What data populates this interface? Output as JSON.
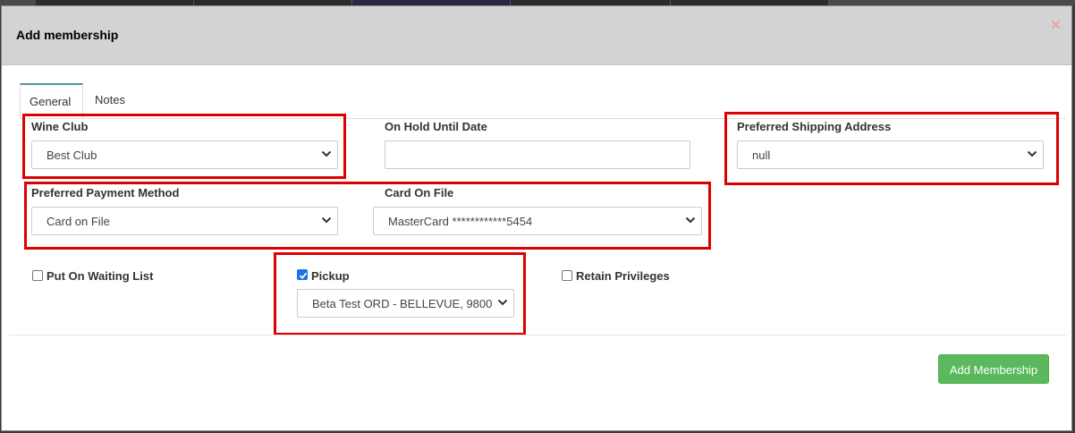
{
  "modal": {
    "title": "Add membership",
    "close_label": "×"
  },
  "tabs": [
    {
      "label": "General",
      "active": true
    },
    {
      "label": "Notes",
      "active": false
    }
  ],
  "form": {
    "wine_club": {
      "label": "Wine Club",
      "value": "Best Club"
    },
    "on_hold_until_date": {
      "label": "On Hold Until Date",
      "value": ""
    },
    "preferred_shipping_address": {
      "label": "Preferred Shipping Address",
      "value": "null"
    },
    "preferred_payment_method": {
      "label": "Preferred Payment Method",
      "value": "Card on File"
    },
    "card_on_file": {
      "label": "Card On File",
      "value": "MasterCard ************5454"
    },
    "put_on_waiting_list": {
      "label": "Put On Waiting List",
      "checked": false
    },
    "pickup": {
      "label": "Pickup",
      "checked": true,
      "location_value": "Beta Test ORD - BELLEVUE, 9800"
    },
    "retain_privileges": {
      "label": "Retain Privileges",
      "checked": false
    }
  },
  "footer": {
    "submit_label": "Add Membership"
  },
  "colors": {
    "header_bg": "#d3d3d3",
    "highlight": "#dd0000",
    "primary_button": "#5cb85c",
    "checkbox_checked": "#1a73e8",
    "tab_active_accent": "#4a9a9a"
  }
}
